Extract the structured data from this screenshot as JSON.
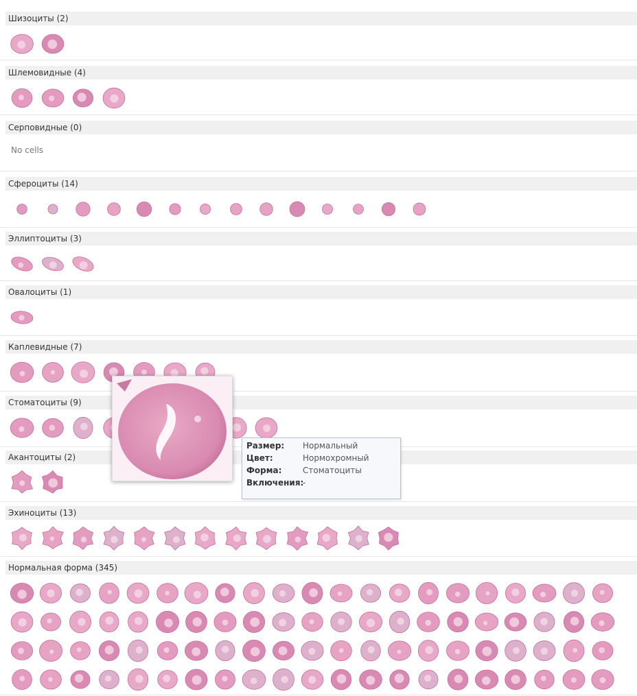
{
  "sections": [
    {
      "label": "Шизоциты (2)",
      "count": 2,
      "empty": false
    },
    {
      "label": "Шлемовидные (4)",
      "count": 4,
      "empty": false
    },
    {
      "label": "Серповидные (0)",
      "count": 0,
      "empty": true,
      "empty_text": "No cells"
    },
    {
      "label": "Сфероциты (14)",
      "count": 14,
      "empty": false
    },
    {
      "label": "Эллиптоциты (3)",
      "count": 3,
      "empty": false
    },
    {
      "label": "Овалоциты (1)",
      "count": 1,
      "empty": false
    },
    {
      "label": "Каплевидные (7)",
      "count": 7,
      "empty": false
    },
    {
      "label": "Стоматоциты (9)",
      "count": 9,
      "empty": false
    },
    {
      "label": "Акантоциты (2)",
      "count": 2,
      "empty": false
    },
    {
      "label": "Эхиноциты (13)",
      "count": 13,
      "empty": false
    },
    {
      "label": "Нормальная форма (345)",
      "count": 345,
      "empty": false
    }
  ],
  "tooltip": {
    "size_label": "Размер:",
    "size_value": "Нормальный",
    "color_label": "Цвет:",
    "color_value": "Нормохромный",
    "shape_label": "Форма:",
    "shape_value": "Стоматоциты",
    "inclusions_label": "Включения:",
    "inclusions_value": "-"
  },
  "colors": {
    "cell_fill": "#e7a3c4",
    "cell_dark": "#c46f98",
    "cell_light": "#f7dde9",
    "header_bg": "#f0f0f0"
  }
}
